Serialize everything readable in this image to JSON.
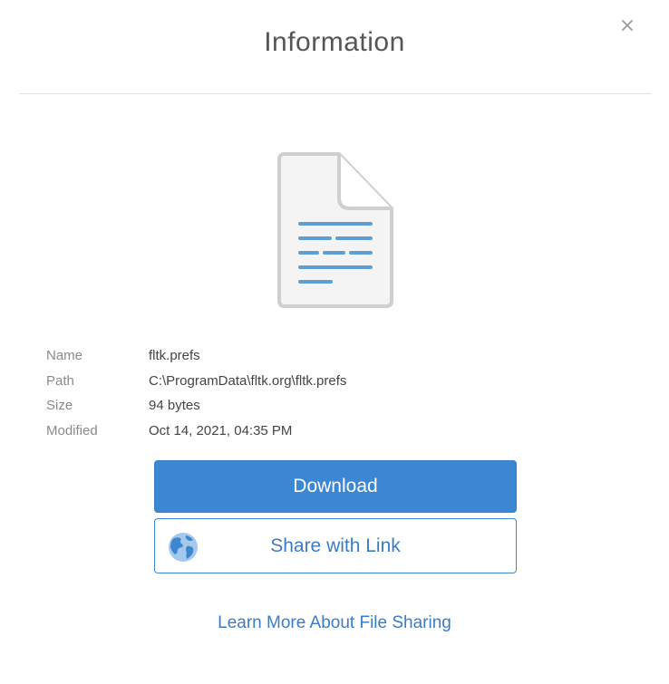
{
  "dialog": {
    "title": "Information",
    "close_label": "×"
  },
  "file": {
    "icon": "document-icon",
    "details": [
      {
        "label": "Name",
        "value": "fltk.prefs"
      },
      {
        "label": "Path",
        "value": "C:\\ProgramData\\fltk.org\\fltk.prefs"
      },
      {
        "label": "Size",
        "value": "94 bytes"
      },
      {
        "label": "Modified",
        "value": "Oct 14, 2021, 04:35 PM"
      }
    ]
  },
  "actions": {
    "download_label": "Download",
    "share_label": "Share with Link",
    "share_icon": "globe-icon",
    "learn_more_label": "Learn More About File Sharing"
  },
  "colors": {
    "accent": "#3b87d4",
    "link": "#3b7cc2",
    "icon_lines": "#5b9fd4"
  }
}
